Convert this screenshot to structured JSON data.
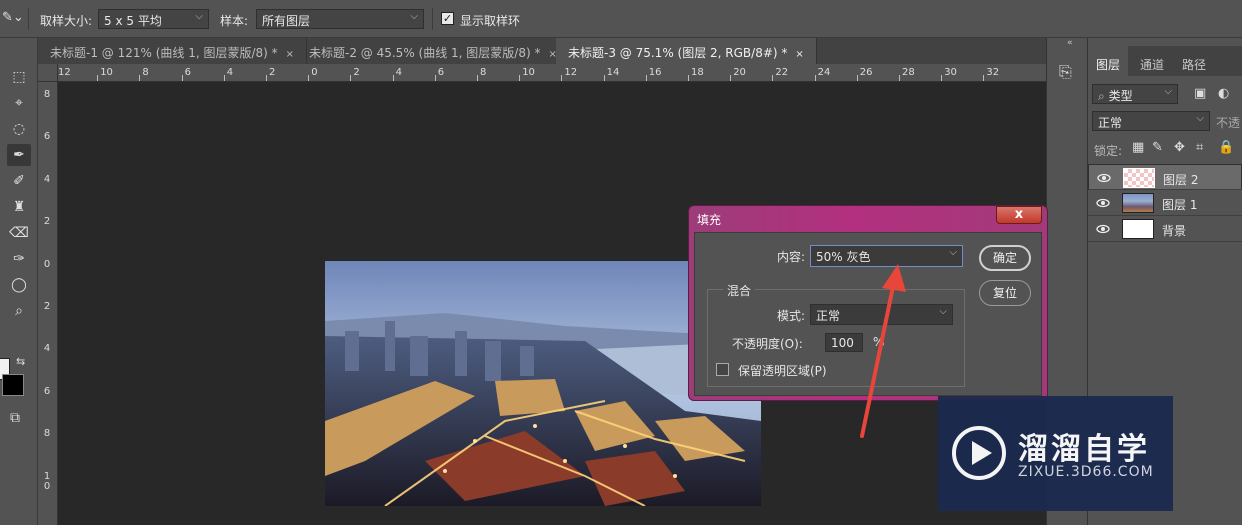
{
  "options_bar": {
    "sample_size_label": "取样大小:",
    "sample_size_value": "5 x 5 平均",
    "sample_label": "样本:",
    "sample_value": "所有图层",
    "show_ring_label": "显示取样环"
  },
  "tabs": [
    {
      "label": "未标题-1 @ 121% (曲线 1, 图层蒙版/8) *",
      "close": "×"
    },
    {
      "label": "未标题-2 @ 45.5% (曲线 1, 图层蒙版/8) *",
      "close": "×"
    },
    {
      "label": "未标题-3 @ 75.1% (图层 2, RGB/8#) *",
      "close": "×"
    }
  ],
  "ruler": {
    "h_ticks": [
      "12",
      "10",
      "8",
      "6",
      "4",
      "2",
      "0",
      "2",
      "4",
      "6",
      "8",
      "10",
      "12",
      "14",
      "16",
      "18",
      "20",
      "22",
      "24",
      "26",
      "28",
      "30",
      "32"
    ],
    "v_ticks": [
      "8",
      "6",
      "4",
      "2",
      "0",
      "2",
      "4",
      "6",
      "8",
      "10"
    ]
  },
  "layers_panel": {
    "tabs": [
      "图层",
      "通道",
      "路径"
    ],
    "filter_label": "类型",
    "blend_mode": "正常",
    "opacity_label": "不透",
    "lock_label": "锁定:",
    "layers": [
      {
        "name": "图层 2",
        "selected": true
      },
      {
        "name": "图层 1",
        "selected": false
      },
      {
        "name": "背景",
        "selected": false
      }
    ]
  },
  "dialog": {
    "title": "填充",
    "close": "x",
    "content_label": "内容:",
    "content_value": "50% 灰色",
    "blend_group_label": "混合",
    "mode_label": "模式:",
    "mode_value": "正常",
    "opacity_label": "不透明度(O):",
    "opacity_value": "100",
    "opacity_unit": "%",
    "preserve_label": "保留透明区域(P)",
    "ok_label": "确定",
    "reset_label": "复位"
  },
  "watermark": {
    "title": "溜溜自学",
    "url": "ZIXUE.3D66.COM"
  },
  "colors": {
    "accent_arrow": "#e8463a",
    "dialog_title_bar": "#b2307f",
    "panel_bg": "#535353"
  }
}
